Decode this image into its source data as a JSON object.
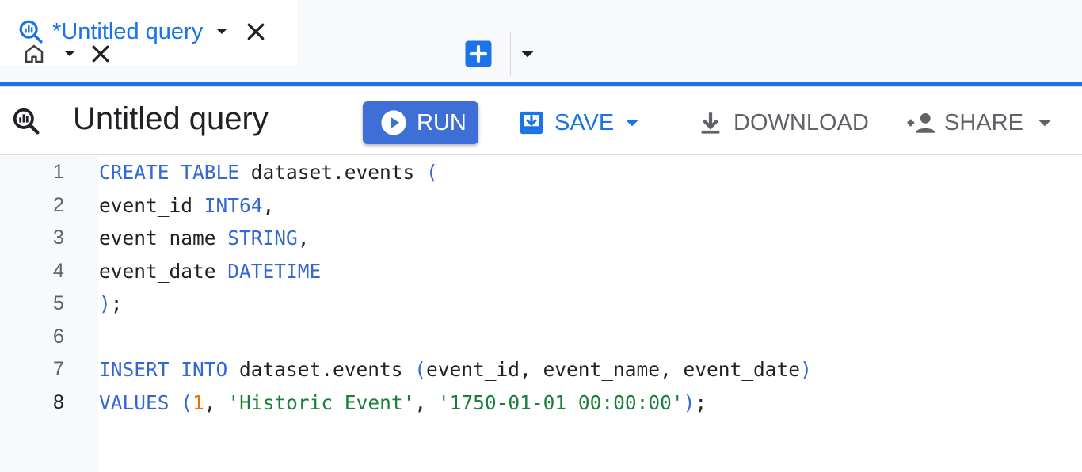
{
  "tabs": {
    "home": {
      "icon": "home-icon"
    },
    "query": {
      "title": "*Untitled query",
      "icon": "query-icon"
    },
    "new_tab": {
      "icon": "add-box-icon"
    }
  },
  "toolbar": {
    "query_title": "Untitled query",
    "run_label": "RUN",
    "save_label": "SAVE",
    "download_label": "DOWNLOAD",
    "share_label": "SHARE"
  },
  "editor": {
    "line_numbers": [
      "1",
      "2",
      "3",
      "4",
      "5",
      "6",
      "7",
      "8"
    ],
    "active_line": "8",
    "lines": [
      [
        {
          "t": "CREATE TABLE",
          "c": "kw"
        },
        {
          "t": " dataset.events ",
          "c": ""
        },
        {
          "t": "(",
          "c": "pn"
        }
      ],
      [
        {
          "t": "event_id ",
          "c": ""
        },
        {
          "t": "INT64",
          "c": "kw"
        },
        {
          "t": ",",
          "c": ""
        }
      ],
      [
        {
          "t": "event_name ",
          "c": ""
        },
        {
          "t": "STRING",
          "c": "kw"
        },
        {
          "t": ",",
          "c": ""
        }
      ],
      [
        {
          "t": "event_date ",
          "c": ""
        },
        {
          "t": "DATETIME",
          "c": "kw"
        }
      ],
      [
        {
          "t": ")",
          "c": "pn"
        },
        {
          "t": ";",
          "c": ""
        }
      ],
      [],
      [
        {
          "t": "INSERT INTO",
          "c": "kw"
        },
        {
          "t": " dataset.events ",
          "c": ""
        },
        {
          "t": "(",
          "c": "pn"
        },
        {
          "t": "event_id, event_name, event_date",
          "c": ""
        },
        {
          "t": ")",
          "c": "pn"
        }
      ],
      [
        {
          "t": "VALUES ",
          "c": "kw"
        },
        {
          "t": "(",
          "c": "pn"
        },
        {
          "t": "1",
          "c": "num"
        },
        {
          "t": ", ",
          "c": ""
        },
        {
          "t": "'Historic Event'",
          "c": "str"
        },
        {
          "t": ", ",
          "c": ""
        },
        {
          "t": "'1750-01-01 00:00:00'",
          "c": "str"
        },
        {
          "t": ")",
          "c": "pn"
        },
        {
          "t": ";",
          "c": ""
        }
      ]
    ]
  },
  "colors": {
    "accent": "#1a73e8",
    "run_button": "#3d6fd6",
    "keyword": "#3367d6",
    "string": "#188038",
    "number": "#e8710a"
  }
}
